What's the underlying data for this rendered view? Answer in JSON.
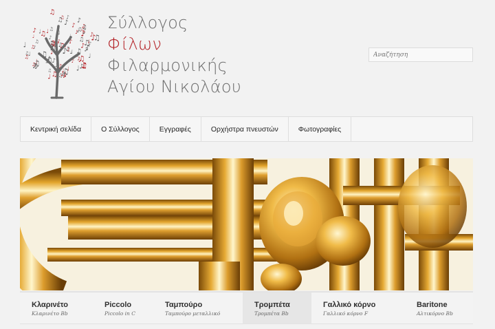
{
  "site": {
    "title_lines": [
      "Σύλλογος",
      "Φίλων",
      "Φιλαρμονικής",
      "Αγίου Νικολάου"
    ],
    "accent_color": "#b21f24",
    "logo_icon": "music-note-tree-icon"
  },
  "search": {
    "placeholder": "Αναζήτηση"
  },
  "nav": {
    "items": [
      {
        "label": "Κεντρική σελίδα"
      },
      {
        "label": "Ο Σύλλογος"
      },
      {
        "label": "Εγγραφές"
      },
      {
        "label": "Ορχήστρα πνευστών"
      },
      {
        "label": "Φωτογραφίες"
      }
    ]
  },
  "hero": {
    "image": "golden-trumpet-valves-closeup"
  },
  "slider_tabs": {
    "active_index": 3,
    "items": [
      {
        "title": "Κλαρινέτο",
        "subtitle": "Κλαρινέτο Bb"
      },
      {
        "title": "Piccolo",
        "subtitle": "Piccolo in C"
      },
      {
        "title": "Ταμπούρο",
        "subtitle": "Ταμπούρο μεταλλικό"
      },
      {
        "title": "Τρομπέτα",
        "subtitle": "Τρομπέτα Bb"
      },
      {
        "title": "Γαλλικό κόρνο",
        "subtitle": "Γαλλικό κόρνο F"
      },
      {
        "title": "Baritone",
        "subtitle": "Αλτικόρνο Bb"
      }
    ]
  }
}
